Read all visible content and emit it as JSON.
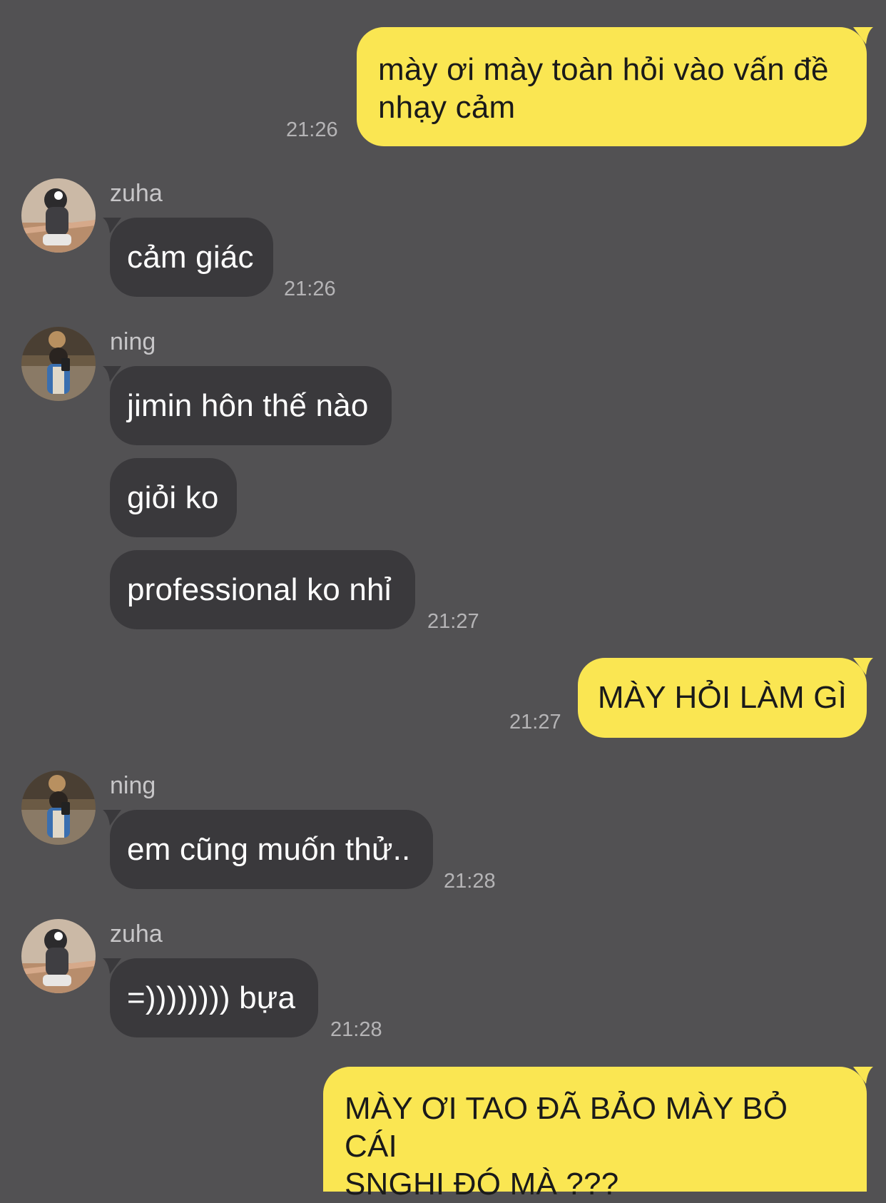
{
  "messages": [
    {
      "side": "out",
      "text": "mày ơi mày toàn hỏi vào vấn đề\nnhạy cảm",
      "time": "21:26"
    },
    {
      "side": "in",
      "sender": "zuha",
      "texts": [
        "cảm giác"
      ],
      "time": "21:26"
    },
    {
      "side": "in",
      "sender": "ning",
      "texts": [
        "jimin hôn thế nào",
        "giỏi ko",
        "professional ko nhỉ"
      ],
      "time": "21:27"
    },
    {
      "side": "out",
      "text": "MÀY HỎI LÀM GÌ",
      "time": "21:27"
    },
    {
      "side": "in",
      "sender": "ning",
      "texts": [
        "em cũng muốn thử.."
      ],
      "time": "21:28"
    },
    {
      "side": "in",
      "sender": "zuha",
      "texts": [
        "=)))))))) bựa"
      ],
      "time": "21:28"
    },
    {
      "side": "out",
      "text": "MÀY ƠI TAO ĐÃ BẢO MÀY BỎ CÁI\nSNGHI ĐÓ MÀ ???",
      "time": ""
    }
  ],
  "colors": {
    "background": "#525153",
    "outgoing_bubble": "#fae652",
    "incoming_bubble": "#3a393c"
  },
  "icons": {
    "avatar_zuha": "avatar-photo-zuha",
    "avatar_ning": "avatar-photo-ning"
  }
}
